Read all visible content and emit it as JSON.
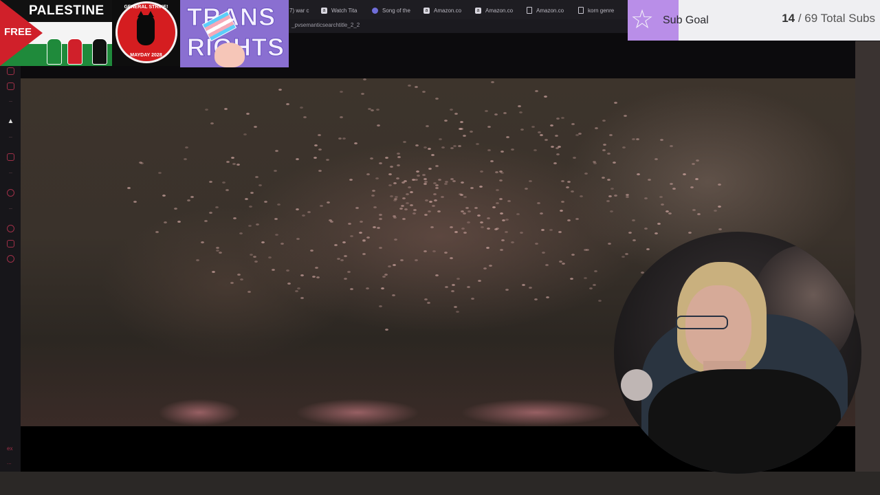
{
  "browser": {
    "tabs": [
      {
        "label": "7) war c",
        "icon": "page-icon"
      },
      {
        "label": "Watch Tita",
        "icon": "page-icon"
      },
      {
        "label": "Song of the",
        "icon": "globe-icon"
      },
      {
        "label": "Amazon.co",
        "icon": "page-icon"
      },
      {
        "label": "Amazon.co",
        "icon": "page-icon"
      },
      {
        "label": "Amazon.co",
        "icon": "doc-icon"
      },
      {
        "label": "korn genre",
        "icon": "doc-icon"
      }
    ],
    "url_fragment": "_pvsemanticsearchtitle_2_2"
  },
  "sidebar": {
    "bottom_label": "ex",
    "more_label": "..."
  },
  "overlays": {
    "palestine": {
      "line1": "PALESTINE",
      "line2": "FREE"
    },
    "general_strike": {
      "line1": "GENERAL STRIKE!",
      "line2": "MAYDAY 2028"
    },
    "trans_rights": {
      "line1": "TRANS",
      "line2": "RIGHTS"
    }
  },
  "sub_goal": {
    "label": "Sub Goal",
    "current": "14",
    "rest": " / 69 Total Subs",
    "icon": "star-icon",
    "accent": "#b98ee8"
  },
  "colors": {
    "sidebar_accent": "#a03048",
    "pal_red": "#d0202a",
    "pal_green": "#1f8a3b",
    "strike_red": "#d51d20",
    "trans_purple": "#8a6fd1"
  }
}
